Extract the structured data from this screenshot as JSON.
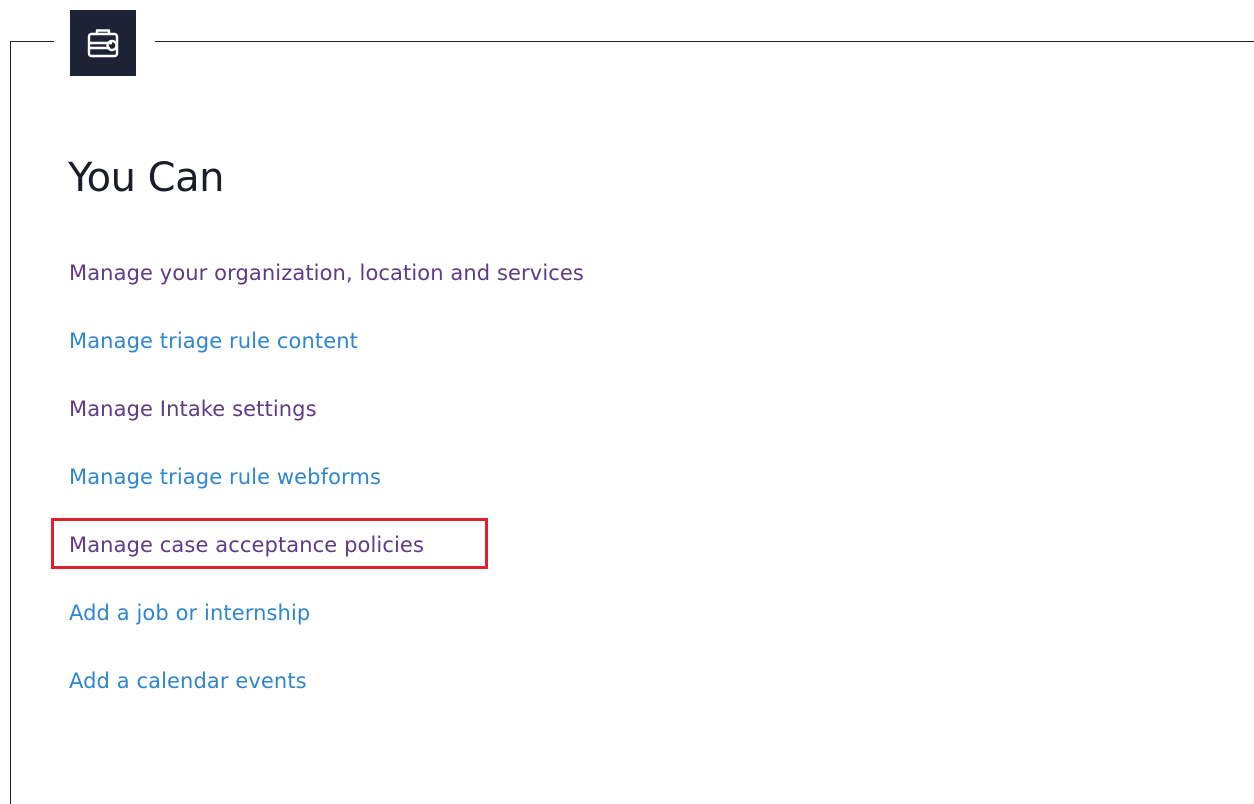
{
  "section": {
    "icon": "toolbox-wrench-icon",
    "heading": "You Can"
  },
  "links": [
    {
      "label": "Manage your organization, location and services",
      "visited": true
    },
    {
      "label": "Manage triage rule content",
      "visited": false
    },
    {
      "label": "Manage Intake settings",
      "visited": true
    },
    {
      "label": "Manage triage rule webforms",
      "visited": false
    },
    {
      "label": "Manage case acceptance policies",
      "visited": true,
      "highlighted": true
    },
    {
      "label": "Add a job or internship",
      "visited": false
    },
    {
      "label": "Add a calendar events",
      "visited": false
    }
  ],
  "colors": {
    "visited_link": "#5d3b86",
    "unvisited_link": "#2f86d0",
    "highlight": "#e0202e",
    "icon_background": "#1d2236",
    "heading": "#1a1d2a"
  }
}
